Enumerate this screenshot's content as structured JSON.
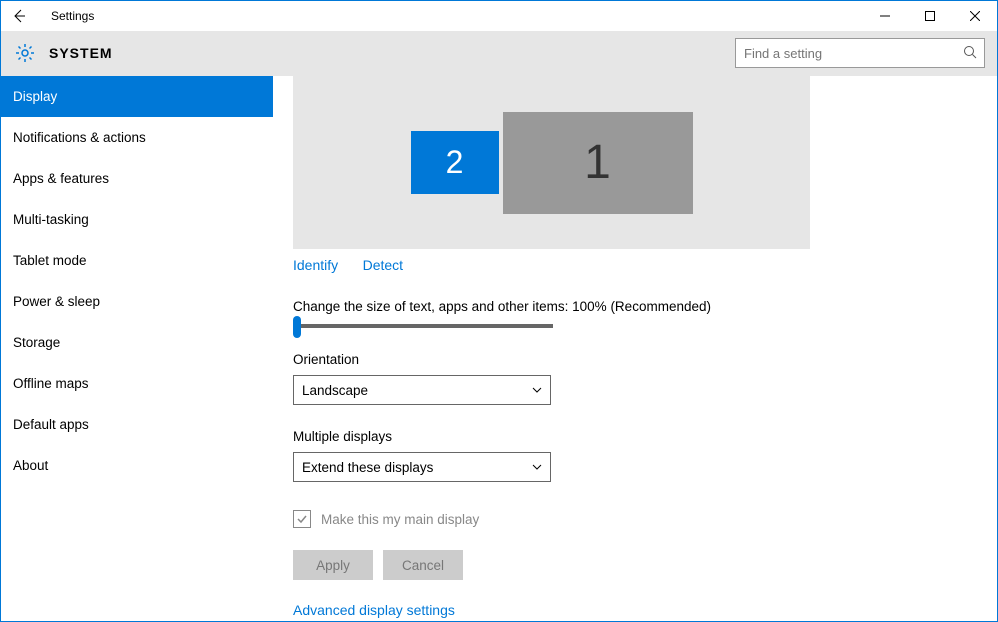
{
  "window": {
    "title": "Settings"
  },
  "header": {
    "title": "SYSTEM",
    "search_placeholder": "Find a setting"
  },
  "sidebar": {
    "items": [
      {
        "label": "Display",
        "active": true
      },
      {
        "label": "Notifications & actions"
      },
      {
        "label": "Apps & features"
      },
      {
        "label": "Multi-tasking"
      },
      {
        "label": "Tablet mode"
      },
      {
        "label": "Power & sleep"
      },
      {
        "label": "Storage"
      },
      {
        "label": "Offline maps"
      },
      {
        "label": "Default apps"
      },
      {
        "label": "About"
      }
    ]
  },
  "content": {
    "monitors": {
      "m2": "2",
      "m1": "1"
    },
    "identify": "Identify",
    "detect": "Detect",
    "scale_label": "Change the size of text, apps and other items: 100% (Recommended)",
    "orientation_label": "Orientation",
    "orientation_value": "Landscape",
    "multidisplay_label": "Multiple displays",
    "multidisplay_value": "Extend these displays",
    "maindisplay_label": "Make this my main display",
    "apply": "Apply",
    "cancel": "Cancel",
    "advanced": "Advanced display settings"
  }
}
